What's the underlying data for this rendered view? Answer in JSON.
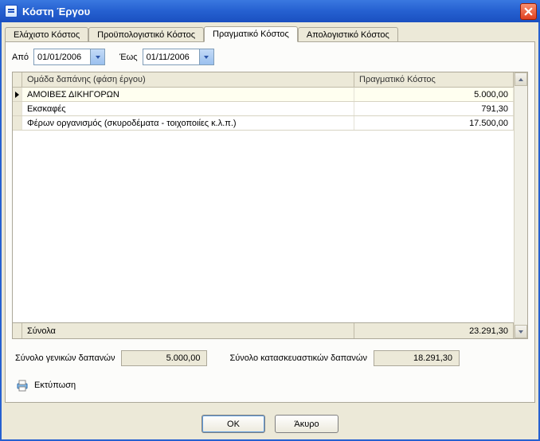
{
  "window": {
    "title": "Κόστη Έργου"
  },
  "tabs": [
    {
      "label": "Ελάχιστο Κόστος"
    },
    {
      "label": "Προϋπολογιστικό Κόστος"
    },
    {
      "label": "Πραγματικό Κόστος"
    },
    {
      "label": "Απολογιστικό Κόστος"
    }
  ],
  "dates": {
    "from_label": "Από",
    "from_value": "01/01/2006",
    "to_label": "Έως",
    "to_value": "01/11/2006"
  },
  "grid": {
    "header_group": "Ομάδα δαπάνης (φάση έργου)",
    "header_cost": "Πραγματικό Κόστος",
    "rows": [
      {
        "group": "ΑΜΟΙΒΕΣ ΔΙΚΗΓΟΡΩΝ",
        "cost": "5.000,00"
      },
      {
        "group": "Εκσκαφές",
        "cost": "791,30"
      },
      {
        "group": "Φέρων οργανισμός (σκυροδέματα - τοιχοποιίες κ.λ.π.)",
        "cost": "17.500,00"
      }
    ],
    "totals_label": "Σύνολα",
    "totals_value": "23.291,30"
  },
  "summary": {
    "general_label": "Σύνολο γενικών δαπανών",
    "general_value": "5.000,00",
    "construction_label": "Σύνολο κατασκευαστικών δαπανών",
    "construction_value": "18.291,30"
  },
  "print_label": "Εκτύπωση",
  "buttons": {
    "ok": "OK",
    "cancel": "Άκυρο"
  }
}
